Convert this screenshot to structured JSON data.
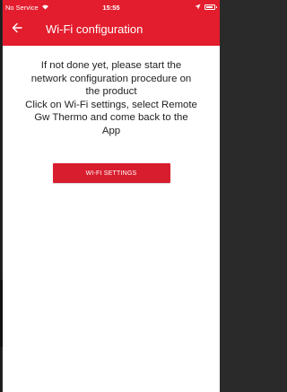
{
  "colors": {
    "accent": "#e31d2d",
    "button": "#d81e2e",
    "text": "#222222",
    "background": "#ffffff"
  },
  "status_bar": {
    "carrier": "No Service",
    "wifi_icon": "wifi-icon",
    "time": "15:55",
    "location_icon": "location-arrow-icon",
    "battery_icon": "battery-icon"
  },
  "toolbar": {
    "back_icon": "back-arrow-icon",
    "title": "Wi-Fi configuration"
  },
  "message": {
    "lines": [
      "If not done yet, please start the",
      "network configuration procedure on",
      "the product",
      "Click on Wi-Fi settings, select Remote",
      "Gw Thermo and come back to the",
      "App"
    ]
  },
  "button": {
    "label": "WI-FI SETTINGS"
  }
}
